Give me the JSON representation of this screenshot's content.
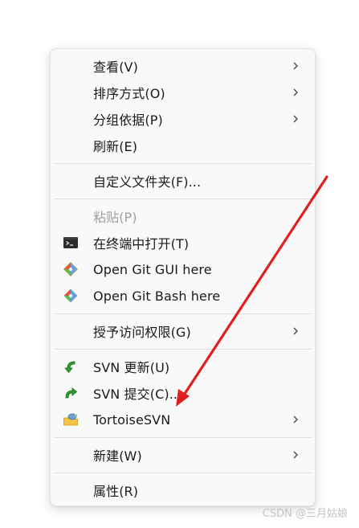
{
  "menu": {
    "items": [
      {
        "label": "查看(V)",
        "submenu": true
      },
      {
        "label": "排序方式(O)",
        "submenu": true
      },
      {
        "label": "分组依据(P)",
        "submenu": true
      },
      {
        "label": "刷新(E)",
        "submenu": false
      },
      {
        "label": "自定义文件夹(F)...",
        "submenu": false
      },
      {
        "label": "粘贴(P)",
        "submenu": false,
        "disabled": true
      },
      {
        "label": "在终端中打开(T)",
        "submenu": false,
        "icon": "terminal-icon"
      },
      {
        "label": "Open Git GUI here",
        "submenu": false,
        "icon": "git-icon"
      },
      {
        "label": "Open Git Bash here",
        "submenu": false,
        "icon": "git-icon"
      },
      {
        "label": "授予访问权限(G)",
        "submenu": true
      },
      {
        "label": "SVN 更新(U)",
        "submenu": false,
        "icon": "svn-update-icon"
      },
      {
        "label": "SVN 提交(C)...",
        "submenu": false,
        "icon": "svn-commit-icon"
      },
      {
        "label": "TortoiseSVN",
        "submenu": true,
        "icon": "tortoisesvn-icon"
      },
      {
        "label": "新建(W)",
        "submenu": true
      },
      {
        "label": "属性(R)",
        "submenu": false
      }
    ]
  },
  "annotation": {
    "arrow_color": "#e02020"
  },
  "watermark": "CSDN @三月姑娘"
}
